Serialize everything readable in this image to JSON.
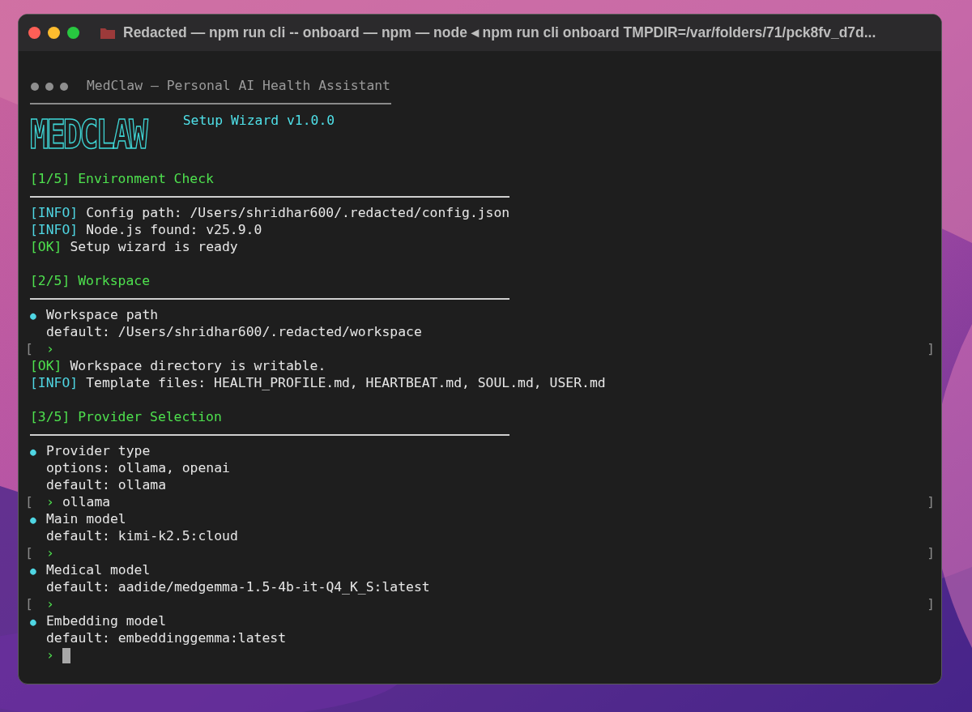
{
  "window": {
    "title": "Redacted — npm run cli -- onboard — npm — node ◂ npm run cli onboard TMPDIR=/var/folders/71/pck8fv_d7d..."
  },
  "header": {
    "title": "MedClaw — Personal AI Health Assistant",
    "logo": "MEDCLAW",
    "subtitle": "Setup Wizard v1.0.0"
  },
  "sections": [
    {
      "heading": "[1/5] Environment Check",
      "lines": [
        {
          "kind": "log",
          "tag": "[INFO]",
          "color": "#4fd6e3",
          "text": "Config path: /Users/shridhar600/.redacted/config.json"
        },
        {
          "kind": "log",
          "tag": "[INFO]",
          "color": "#4fd6e3",
          "text": "Node.js found: v25.9.0"
        },
        {
          "kind": "log",
          "tag": "[OK]",
          "color": "#4ee04e",
          "text": "Setup wizard is ready"
        }
      ]
    },
    {
      "heading": "[2/5] Workspace",
      "lines": [
        {
          "kind": "question",
          "bullet": "●",
          "text": "Workspace path"
        },
        {
          "kind": "detail",
          "text": "default: /Users/shridhar600/.redacted/workspace"
        },
        {
          "kind": "input",
          "open": "[",
          "prompt": "›",
          "close": "]",
          "cursor": false
        },
        {
          "kind": "log",
          "tag": "[OK]",
          "color": "#4ee04e",
          "text": "Workspace directory is writable."
        },
        {
          "kind": "log",
          "tag": "[INFO]",
          "color": "#4fd6e3",
          "text": "Template files: HEALTH_PROFILE.md, HEARTBEAT.md, SOUL.md, USER.md"
        }
      ]
    },
    {
      "heading": "[3/5] Provider Selection",
      "lines": [
        {
          "kind": "question",
          "bullet": "●",
          "text": "Provider type"
        },
        {
          "kind": "detail",
          "text": "options: ollama, openai"
        },
        {
          "kind": "detail",
          "text": "default: ollama"
        },
        {
          "kind": "input",
          "open": "[",
          "prompt": "›",
          "value": "ollama",
          "close": "]",
          "cursor": false
        },
        {
          "kind": "question",
          "bullet": "●",
          "text": "Main model"
        },
        {
          "kind": "detail",
          "text": "default: kimi-k2.5:cloud"
        },
        {
          "kind": "input",
          "open": "[",
          "prompt": "›",
          "close": "]",
          "cursor": false
        },
        {
          "kind": "question",
          "bullet": "●",
          "text": "Medical model"
        },
        {
          "kind": "detail",
          "text": "default: aadide/medgemma-1.5-4b-it-Q4_K_S:latest"
        },
        {
          "kind": "input",
          "open": "[",
          "prompt": "›",
          "close": "]",
          "cursor": false
        },
        {
          "kind": "question",
          "bullet": "●",
          "text": "Embedding model"
        },
        {
          "kind": "detail",
          "text": "default: embeddinggemma:latest"
        },
        {
          "kind": "input",
          "prompt": "›",
          "cursor": true
        }
      ]
    }
  ]
}
